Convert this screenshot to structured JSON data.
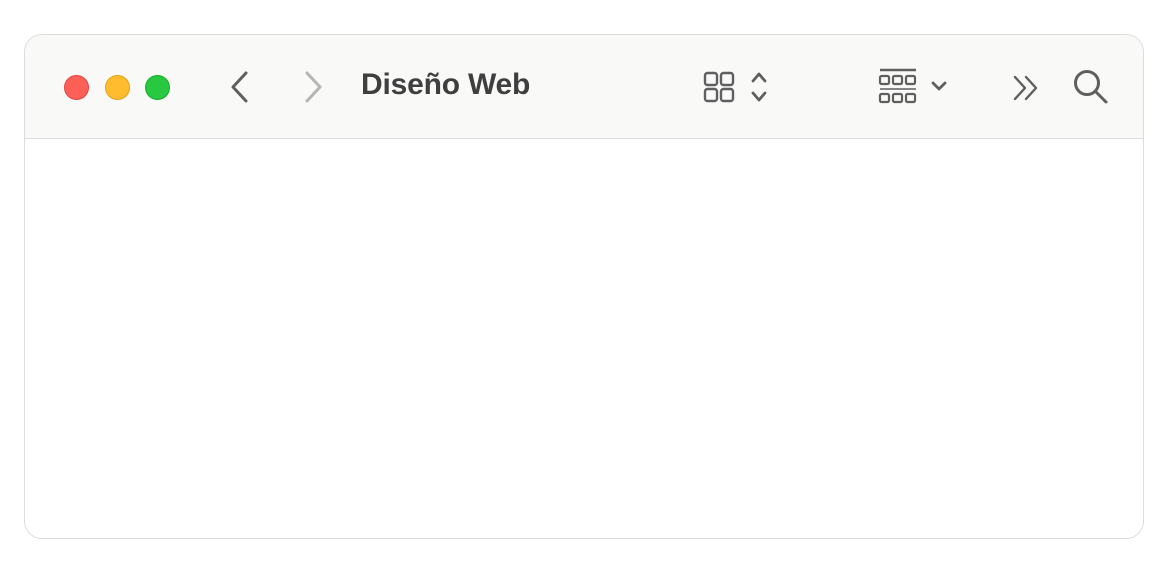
{
  "window": {
    "title": "Diseño Web"
  },
  "toolbar": {
    "icons": {
      "back": "chevron-left-icon",
      "forward": "chevron-right-icon",
      "view_mode": "icon-grid-view-icon",
      "view_mode_stepper": "up-down-chevron-icon",
      "group": "group-by-icon",
      "group_menu": "chevron-down-icon",
      "overflow": "double-chevron-right-icon",
      "search": "magnifying-glass-icon"
    }
  },
  "colors": {
    "close": "#fe5f57",
    "minimize": "#febc2e",
    "zoom": "#28c840",
    "toolbar_bg": "#f9f9f8",
    "icon": "#5f5f5f",
    "icon_disabled": "#b5b5b5"
  }
}
